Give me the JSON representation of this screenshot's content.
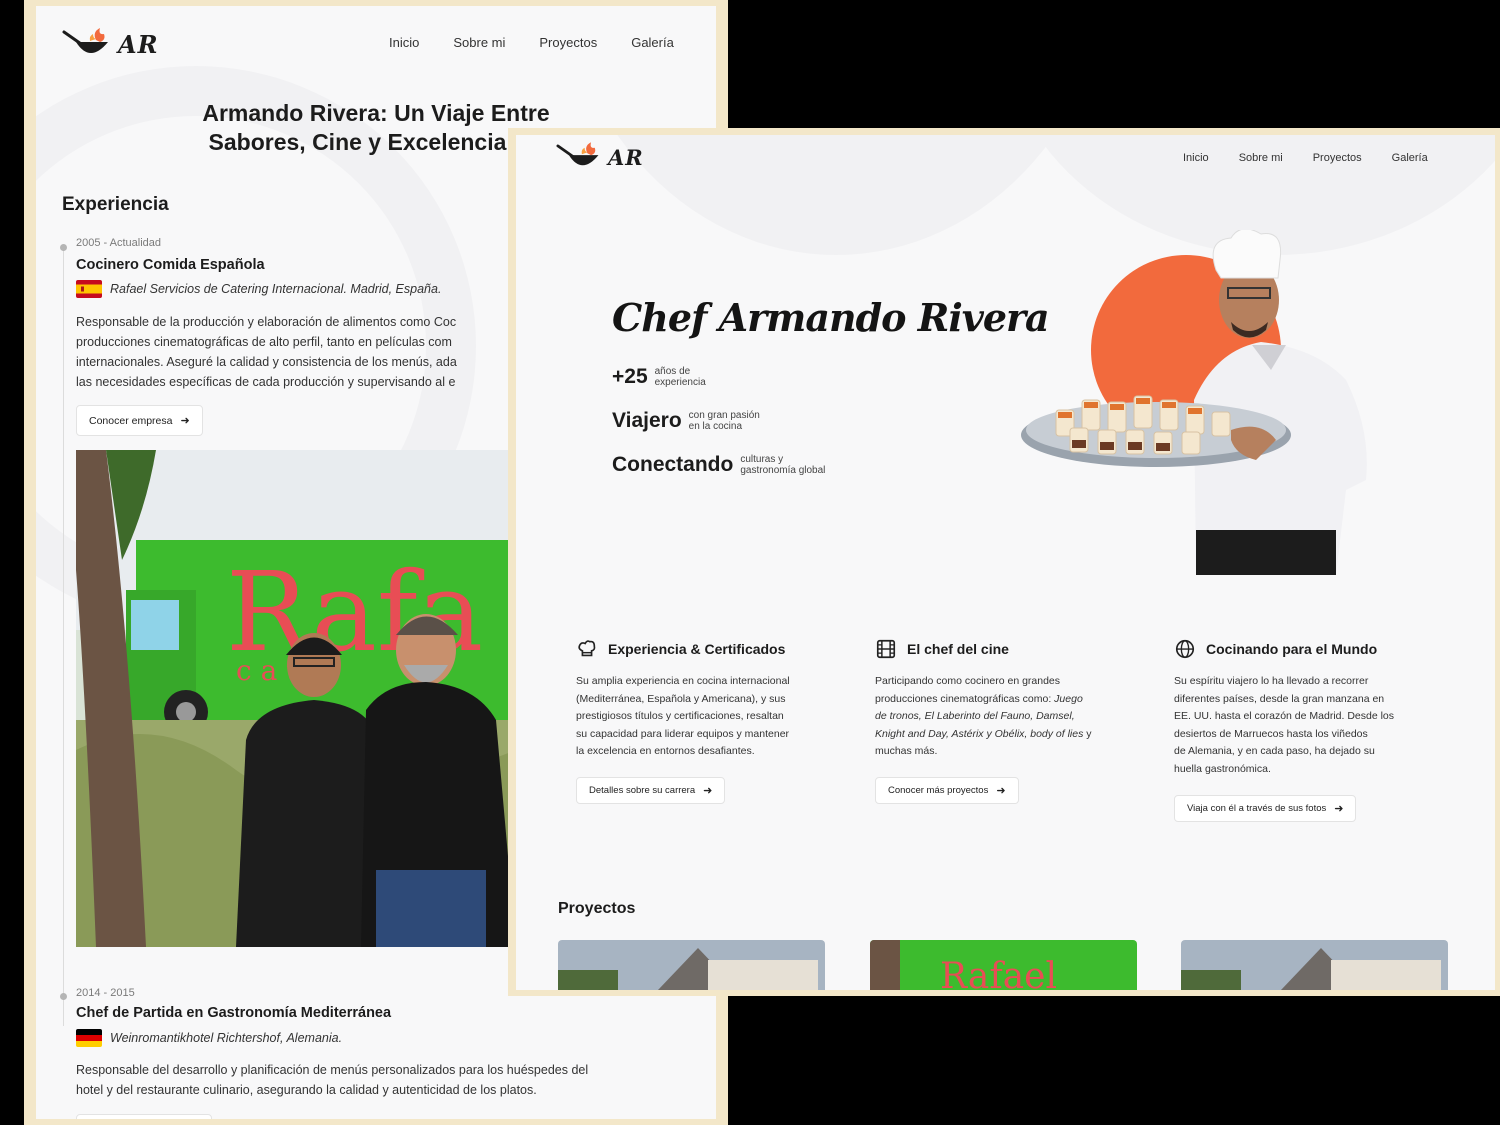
{
  "logo_text": "AR",
  "nav": [
    "Inicio",
    "Sobre mi",
    "Proyectos",
    "Galería"
  ],
  "back_page": {
    "hero_title_line1": "Armando Rivera: Un Viaje Entre",
    "hero_title_line2": "Sabores, Cine y Excelencia Cu",
    "experience_title": "Experiencia",
    "jobs": [
      {
        "period": "2005 - Actualidad",
        "title": "Cocinero Comida Española",
        "company": "Rafael Servicios de Catering Internacional. Madrid, España.",
        "desc_lines": [
          "Responsable de la producción y elaboración de alimentos como Coc",
          "producciones cinematográficas de alto perfil, tanto en películas com",
          "internacionales. Aseguré la calidad y consistencia de los menús, ada",
          "las necesidades específicas de cada producción y supervisando al e"
        ],
        "button": "Conocer empresa"
      },
      {
        "period": "2014 - 2015",
        "title": "Chef de Partida en Gastronomía Mediterránea",
        "company": "Weinromantikhotel Richtershof, Alemania.",
        "desc_lines": [
          "Responsable del desarrollo y planificación de menús personalizados para los huéspedes del",
          "hotel y del restaurante culinario, asegurando la calidad y autenticidad de los platos."
        ]
      }
    ]
  },
  "front_page": {
    "hero_title": "Chef Armando Rivera",
    "stats": [
      {
        "main": "+25",
        "sub1": "años de",
        "sub2": "experiencia"
      },
      {
        "main": "Viajero",
        "sub1": "con gran pasión",
        "sub2": "en la cocina"
      },
      {
        "main": "Conectando",
        "sub1": "culturas y",
        "sub2": "gastronomía global"
      }
    ],
    "features": [
      {
        "title": "Experiencia & Certificados",
        "lines": [
          "Su amplia experiencia en cocina internacional",
          "(Mediterránea, Española y Americana), y sus",
          "prestigiosos títulos y certificaciones, resaltan",
          "su capacidad para liderar equipos y mantener",
          "la excelencia en entornos desafiantes."
        ],
        "button": "Detalles sobre su carrera"
      },
      {
        "title": "El chef del cine",
        "line1": "Participando como cocinero en grandes",
        "line2_a": "producciones cinematográficas como: ",
        "line2_b": "Juego",
        "line3": "de tronos, El Laberinto del Fauno, Damsel,",
        "line4_a": "Knight and Day, Astérix y Obélix, body of lies",
        "line4_b": " y",
        "line5": "muchas más.",
        "button": "Conocer más proyectos"
      },
      {
        "title": "Cocinando para el Mundo",
        "lines": [
          "Su espíritu viajero lo ha llevado a recorrer",
          "diferentes países, desde la gran manzana en",
          "EE. UU. hasta el corazón de Madrid. Desde los",
          "desiertos de Marruecos hasta los viñedos",
          "de Alemania, y en cada paso, ha dejado su",
          "huella gastronómica."
        ],
        "button": "Viaja con él a través de sus fotos"
      }
    ],
    "projects_title": "Proyectos"
  },
  "colors": {
    "accent_orange": "#f26a3d",
    "frame": "#f3e7c9",
    "page_bg": "#f8f8f9",
    "truck_green": "#3dbb2e"
  },
  "icons": [
    "logo-wok-icon",
    "arrow-right-icon",
    "chef-hat-icon",
    "film-icon",
    "globe-icon",
    "spain-flag-icon",
    "germany-flag-icon"
  ]
}
